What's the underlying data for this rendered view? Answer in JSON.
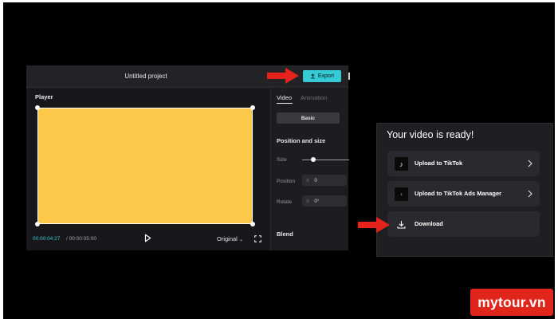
{
  "editor": {
    "project_title": "Untitled project",
    "export_label": "Export",
    "player": {
      "label": "Player",
      "time_current": "00:00:04:27",
      "time_total": "/ 00:00:05:00",
      "ratio": "Original",
      "frame_color": "#fcc84a"
    },
    "properties": {
      "tabs": [
        {
          "label": "Video",
          "active": true
        },
        {
          "label": "Animation",
          "active": false
        }
      ],
      "basic_label": "Basic",
      "position_size_title": "Position and size",
      "size_label": "Size",
      "position_label": "Position",
      "position_axis": "X",
      "position_value": "0",
      "rotate_label": "Rotate",
      "rotate_axis": "X",
      "rotate_value": "0°",
      "blend_title": "Blend"
    },
    "accent_color": "#36c9d6"
  },
  "dialog": {
    "title": "Your video is ready!",
    "options": [
      {
        "label": "Upload to TikTok",
        "icon": "tiktok-icon"
      },
      {
        "label": "Upload to TikTok Ads Manager",
        "icon": "tiktok-ads-icon"
      },
      {
        "label": "Download",
        "icon": "download-icon"
      }
    ]
  },
  "annotation": {
    "arrow_color": "#e3231c"
  },
  "watermark": {
    "text": "mytour.vn",
    "color": "#e0251b"
  }
}
